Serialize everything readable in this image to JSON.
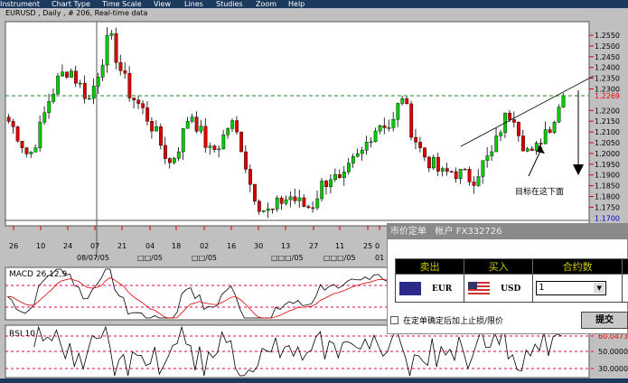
{
  "menu": [
    "Instrument",
    "Chart Type",
    "Time Scale",
    "View",
    "Lines",
    "Studies",
    "Zoom",
    "Help"
  ],
  "title": "EURUSD , Daily , # 206, Real-time data",
  "price_axis": {
    "labels": [
      "1.2550",
      "1.2500",
      "1.2450",
      "1.2400",
      "1.2350",
      "1.2300",
      "1.2200",
      "1.2150",
      "1.2100",
      "1.2050",
      "1.2000",
      "1.1950",
      "1.1900",
      "1.1850",
      "1.1800",
      "1.1750"
    ],
    "current": "1.2269",
    "low_marker": "1.1700"
  },
  "date_axis": {
    "days": [
      "26",
      "10",
      "24",
      "07",
      "21",
      "04",
      "18",
      "02",
      "16",
      "30",
      "13",
      "27",
      "11",
      "25",
      "0"
    ],
    "months": [
      "08/07/05",
      "□□/05",
      "□□/05",
      "□□□/05",
      "□□□/05",
      "01"
    ]
  },
  "annotation": "目标在这下面",
  "macd": {
    "label": "MACD 26,12,9"
  },
  "rsi": {
    "label": "RSI 10",
    "levels": [
      "50.0000",
      "30.0000"
    ],
    "current": "60.0473"
  },
  "chart_data": {
    "type": "candlestick",
    "price_range": [
      1.17,
      1.2575
    ],
    "key_closes": [
      1.215,
      1.208,
      1.198,
      1.21,
      1.225,
      1.235,
      1.24,
      1.232,
      1.225,
      1.24,
      1.255,
      1.24,
      1.228,
      1.222,
      1.215,
      1.205,
      1.195,
      1.205,
      1.22,
      1.21,
      1.2,
      1.205,
      1.215,
      1.205,
      1.185,
      1.175,
      1.172,
      1.178,
      1.18,
      1.176,
      1.175,
      1.185,
      1.19,
      1.185,
      1.195,
      1.2,
      1.21,
      1.215,
      1.212,
      1.228,
      1.21,
      1.2,
      1.195,
      1.19,
      1.192,
      1.19,
      1.188,
      1.195,
      1.2,
      1.215,
      1.22,
      1.205,
      1.198,
      1.21,
      1.215,
      1.227
    ],
    "current_price": 1.2269
  },
  "order": {
    "title": "市价定单",
    "account_label": "帐户",
    "account": "FX332726",
    "sell": "卖出",
    "buy": "买入",
    "contracts": "合约数",
    "sell_currency": "EUR",
    "buy_currency": "USD",
    "quantity": "1",
    "stop_limit_label": "在定单确定后加上止损/限价",
    "submit": "提交"
  },
  "colors": {
    "up": "#00cc00",
    "down": "#dd0000",
    "menu": "#1c3a5e"
  }
}
